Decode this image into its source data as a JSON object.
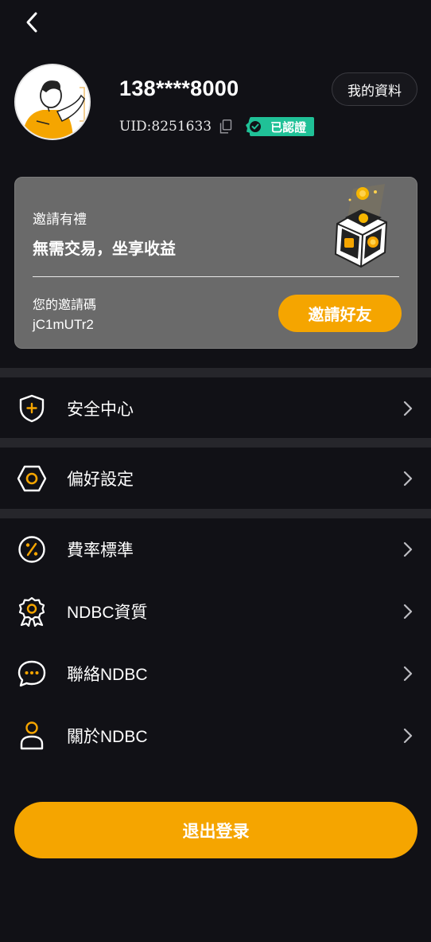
{
  "header": {
    "back_icon": "chevron-left-icon"
  },
  "user": {
    "phone": "138****8000",
    "uid": "UID:8251633",
    "verified_label": "已認證",
    "profile_button": "我的資料"
  },
  "invite": {
    "title": "邀請有禮",
    "subtitle": "無需交易，坐享收益",
    "code_label": "您的邀請碼",
    "code_value": "jC1mUTr2",
    "button": "邀請好友"
  },
  "menu": [
    {
      "label": "安全中心",
      "icon": "shield-plus-icon"
    },
    {
      "label": "偏好設定",
      "icon": "hexagon-settings-icon"
    },
    {
      "label": "費率標準",
      "icon": "percent-icon"
    },
    {
      "label": "NDBC資質",
      "icon": "award-badge-icon"
    },
    {
      "label": "聯絡NDBC",
      "icon": "chat-bubble-icon"
    },
    {
      "label": "關於NDBC",
      "icon": "user-icon"
    }
  ],
  "logout_button": "退出登录",
  "colors": {
    "accent": "#f5a500",
    "verified": "#20c197",
    "background": "#111116",
    "card": "#6a6a6a"
  }
}
